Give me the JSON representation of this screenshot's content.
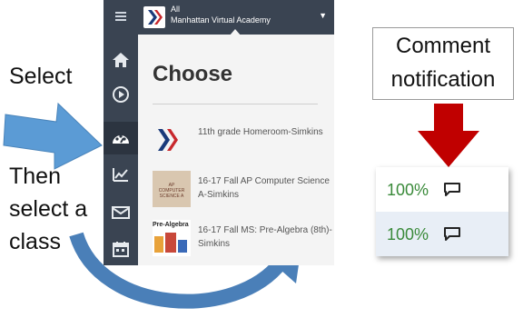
{
  "instructions": {
    "select": "Select",
    "then_line1": "Then",
    "then_line2": "select a",
    "then_line3": "class"
  },
  "app": {
    "sidebar": {
      "icons": [
        "menu-icon",
        "home-icon",
        "play-icon",
        "dashboard-icon",
        "chart-icon",
        "mail-icon",
        "calendar-icon"
      ],
      "active": "dashboard-icon"
    },
    "topbar": {
      "label": "All",
      "org": "Manhattan Virtual Academy"
    },
    "panel": {
      "title": "Choose",
      "classes": [
        {
          "name": "11th grade Homeroom-Simkins",
          "thumb_text": ""
        },
        {
          "name": "16-17 Fall AP Computer Science A-Simkins",
          "thumb_text": "AP COMPUTER SCIENCE A"
        },
        {
          "name": "16-17 Fall MS: Pre-Algebra (8th)- Simkins",
          "thumb_text": "Pre-Algebra"
        }
      ]
    }
  },
  "callout": {
    "line1": "Comment",
    "line2": "notification"
  },
  "grades": [
    {
      "value": "100%",
      "icon": "comment-icon"
    },
    {
      "value": "100%",
      "icon": "comment-icon"
    }
  ],
  "colors": {
    "sidebar": "#3a4452",
    "arrow_blue": "#5b9bd5",
    "arrow_red": "#c00000",
    "grade_green": "#3a8a3a"
  }
}
